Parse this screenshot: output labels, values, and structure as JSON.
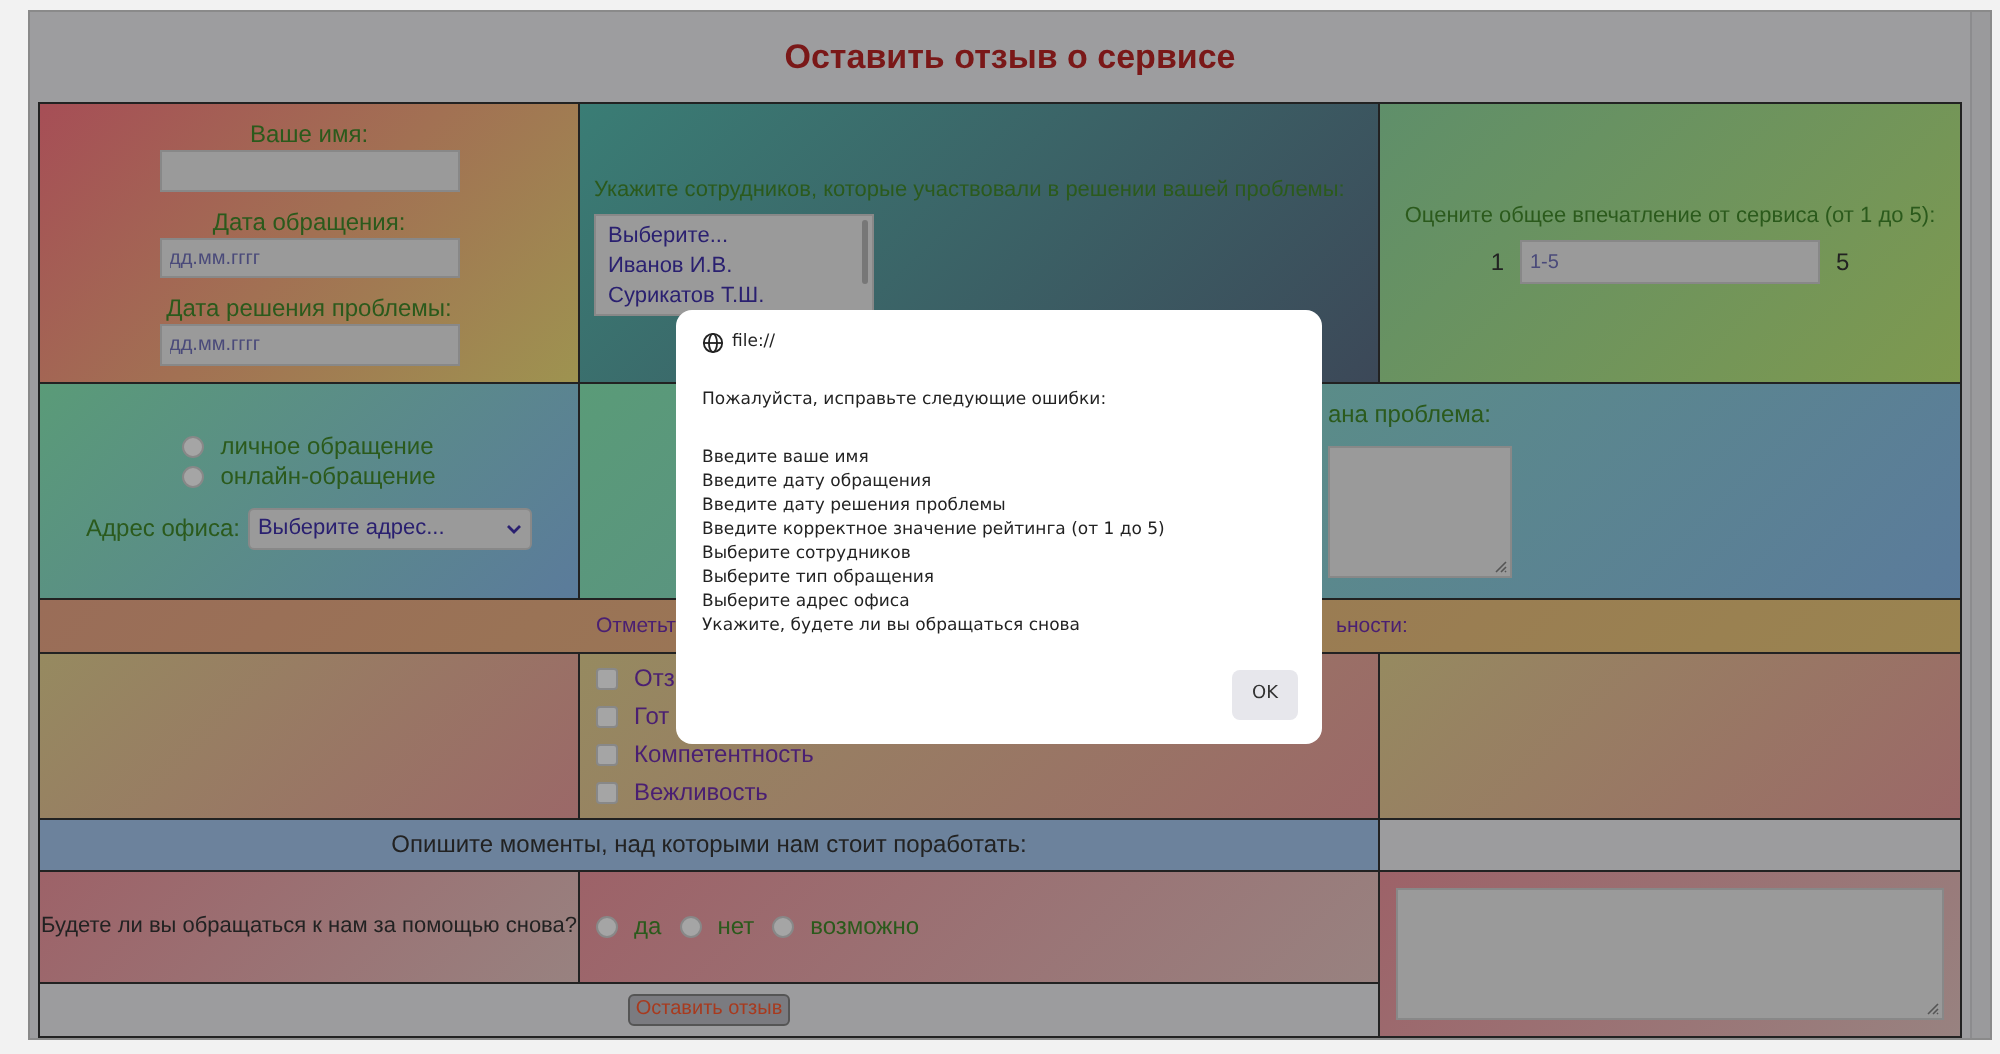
{
  "title": "Оставить отзыв о сервисе",
  "name_field": {
    "label": "Ваше имя:"
  },
  "contact_date": {
    "label": "Дата обращения:",
    "placeholder": "дд.мм.гггг"
  },
  "solved_date": {
    "label": "Дата решения проблемы:",
    "placeholder": "дд.мм.гггг"
  },
  "employees": {
    "label": "Укажите сотрудников, которые участвовали в решении вашей проблемы:",
    "options": [
      {
        "label": "Выберите...",
        "selected": false
      },
      {
        "label": "Иванов И.В.",
        "selected": false
      },
      {
        "label": "Сурикатов Т.Ш.",
        "selected": false
      }
    ]
  },
  "rating": {
    "label": "Оцените общее впечатление от сервиса (от 1 до 5):",
    "min_label": "1",
    "placeholder": "1-5",
    "max_label": "5"
  },
  "contact_type": {
    "options": [
      {
        "label": "личное обращение",
        "selected": false
      },
      {
        "label": "онлайн-обращение",
        "selected": false
      }
    ]
  },
  "office": {
    "label": "Адрес офиса:",
    "value": "Выберите адрес..."
  },
  "problem": {
    "label": "ана проблема:"
  },
  "qualities": {
    "heading_start": "Отметьт",
    "heading_end": "ьности:",
    "items": [
      {
        "label": "Отз",
        "checked": false
      },
      {
        "label": "Гот",
        "checked": false
      },
      {
        "label": "Компетентность",
        "checked": false
      },
      {
        "label": "Вежливость",
        "checked": false
      }
    ]
  },
  "improvements": {
    "label": "Опишите моменты, над которыми нам стоит поработать:"
  },
  "return_visit": {
    "label": "Будете ли вы обращаться к нам за помощью снова?",
    "options": [
      {
        "label": "да",
        "selected": false
      },
      {
        "label": "нет",
        "selected": false
      },
      {
        "label": "возможно",
        "selected": false
      }
    ]
  },
  "submit": {
    "label": "Оставить отзыв"
  },
  "dialog": {
    "origin": "file://",
    "message": "Пожалуйста, исправьте следующие ошибки:",
    "errors": [
      "Введите ваше имя",
      "Введите дату обращения",
      "Введите дату решения проблемы",
      "Введите корректное значение рейтинга (от 1 до 5)",
      "Выберите сотрудников",
      "Выберите тип обращения",
      "Выберите адрес офиса",
      "Укажите, будете ли вы обращаться снова"
    ],
    "ok": "OK"
  }
}
